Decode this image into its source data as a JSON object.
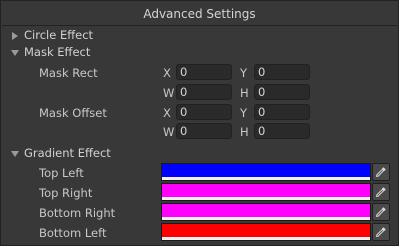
{
  "panel": {
    "title": "Advanced Settings"
  },
  "circle_effect": {
    "label": "Circle Effect",
    "expanded": false
  },
  "mask_effect": {
    "label": "Mask Effect",
    "expanded": true,
    "mask_rect": {
      "label": "Mask Rect",
      "x": "0",
      "y": "0",
      "w": "0",
      "h": "0"
    },
    "mask_offset": {
      "label": "Mask Offset",
      "x": "0",
      "y": "0",
      "w": "0",
      "h": "0"
    }
  },
  "axes": {
    "x": "X",
    "y": "Y",
    "w": "W",
    "h": "H"
  },
  "gradient_effect": {
    "label": "Gradient Effect",
    "expanded": true,
    "top_left": {
      "label": "Top Left",
      "color": "#0000ff"
    },
    "top_right": {
      "label": "Top Right",
      "color": "#ff00ff"
    },
    "bottom_right": {
      "label": "Bottom Right",
      "color": "#ff00ff"
    },
    "bottom_left": {
      "label": "Bottom Left",
      "color": "#ff0000"
    }
  },
  "icons": {
    "foldout_collapsed": "triangle-right-icon",
    "foldout_expanded": "triangle-down-icon",
    "picker": "eyedropper-icon"
  }
}
